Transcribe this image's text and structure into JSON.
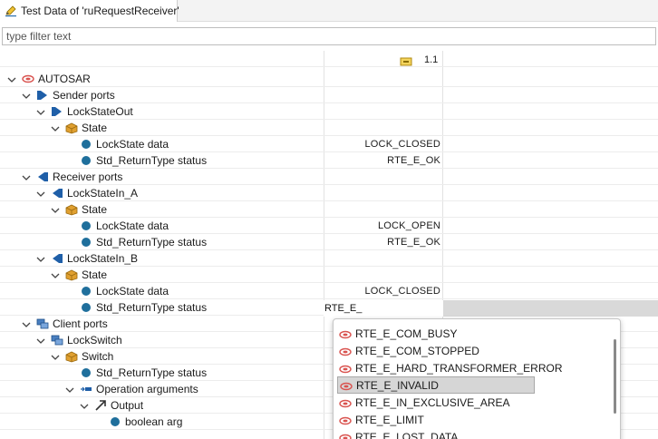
{
  "tab": {
    "title": "Test Data of 'ruRequestReceiver'"
  },
  "filter": {
    "placeholder": "type filter text",
    "value": ""
  },
  "column": {
    "header": "1.1"
  },
  "tree": [
    {
      "label": "AUTOSAR",
      "value": ""
    },
    {
      "label": "Sender ports",
      "value": ""
    },
    {
      "label": "LockStateOut",
      "value": ""
    },
    {
      "label": "State",
      "value": ""
    },
    {
      "label": "LockState data",
      "value": "LOCK_CLOSED"
    },
    {
      "label": "Std_ReturnType status",
      "value": "RTE_E_OK"
    },
    {
      "label": "Receiver ports",
      "value": ""
    },
    {
      "label": "LockStateIn_A",
      "value": ""
    },
    {
      "label": "State",
      "value": ""
    },
    {
      "label": "LockState data",
      "value": "LOCK_OPEN"
    },
    {
      "label": "Std_ReturnType status",
      "value": "RTE_E_OK"
    },
    {
      "label": "LockStateIn_B",
      "value": ""
    },
    {
      "label": "State",
      "value": ""
    },
    {
      "label": "LockState data",
      "value": "LOCK_CLOSED"
    },
    {
      "label": "Std_ReturnType status",
      "value": ""
    },
    {
      "label": "Client ports",
      "value": ""
    },
    {
      "label": "LockSwitch",
      "value": ""
    },
    {
      "label": "Switch",
      "value": ""
    },
    {
      "label": "Std_ReturnType status",
      "value": ""
    },
    {
      "label": "Operation arguments",
      "value": ""
    },
    {
      "label": "Output",
      "value": ""
    },
    {
      "label": "boolean arg",
      "value": ""
    }
  ],
  "editor": {
    "value": "RTE_E_"
  },
  "dropdown": {
    "items": [
      "RTE_E_COM_BUSY",
      "RTE_E_COM_STOPPED",
      "RTE_E_HARD_TRANSFORMER_ERROR",
      "RTE_E_INVALID",
      "RTE_E_IN_EXCLUSIVE_AREA",
      "RTE_E_LIMIT",
      "RTE_E_LOST_DATA"
    ],
    "selected": "RTE_E_INVALID"
  },
  "colors": {
    "leaf_dot": "#1f6f9c",
    "enum_icon": "#d9534f",
    "package_icon": "#e0a030",
    "port_icon": "#1f5fa8"
  }
}
